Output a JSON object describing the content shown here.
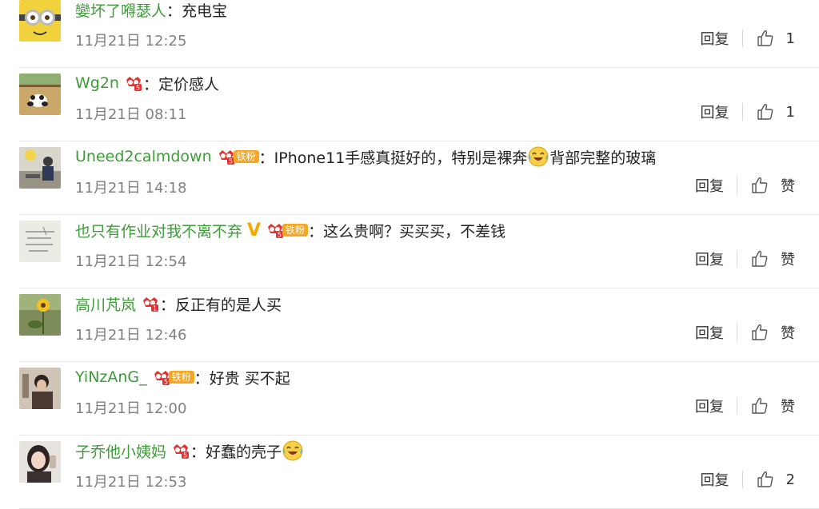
{
  "comments": [
    {
      "username": "孌坏了嘚瑟人",
      "badges": [],
      "text": "充电宝",
      "emoji_after_text": false,
      "time": "11月21日 12:25",
      "reply_label": "回复",
      "like_label": "1",
      "avatar_icon": "minion-avatar"
    },
    {
      "username": "Wg2n",
      "badges": [
        "crown-5"
      ],
      "text": "定价感人",
      "emoji_after_text": false,
      "time": "11月21日 08:11",
      "reply_label": "回复",
      "like_label": "1",
      "avatar_icon": "panda-avatar"
    },
    {
      "username": "Uneed2calmdown",
      "badges": [
        "crown-5",
        "铁粉"
      ],
      "text_before_emoji": "IPhone11手感真挺好的，特别是裸奔",
      "text_after_emoji": "背部完整的玻璃",
      "time": "11月21日 14:18",
      "reply_label": "回复",
      "like_label": "赞",
      "avatar_icon": "person-avatar"
    },
    {
      "username": "也只有作业对我不离不弃",
      "badges": [
        "vip-v",
        "crown-5",
        "铁粉"
      ],
      "text": "这么贵啊？买买买，不差钱",
      "time": "11月21日 12:54",
      "reply_label": "回复",
      "like_label": "赞",
      "avatar_icon": "note-avatar"
    },
    {
      "username": "高川芃岚",
      "badges": [
        "crown-1"
      ],
      "text": "反正有的是人买",
      "time": "11月21日 12:46",
      "reply_label": "回复",
      "like_label": "赞",
      "avatar_icon": "flower-avatar"
    },
    {
      "username": "YiNzAnG_",
      "badges": [
        "crown-5",
        "铁粉"
      ],
      "text": "好贵 买不起",
      "time": "11月21日 12:00",
      "reply_label": "回复",
      "like_label": "赞",
      "avatar_icon": "girl-avatar"
    },
    {
      "username": "子乔他小姨妈",
      "badges": [
        "crown-5"
      ],
      "text_before_emoji": "好蠢的壳子",
      "text_after_emoji": "",
      "time": "11月21日 12:53",
      "reply_label": "回复",
      "like_label": "2",
      "avatar_icon": "woman-avatar"
    }
  ],
  "separator": "：",
  "iron_fan_label": "铁粉",
  "colors": {
    "username": "#3d9b38",
    "time": "#808080",
    "badge_orange": "#f5a623",
    "crown_red": "#e8312f"
  }
}
